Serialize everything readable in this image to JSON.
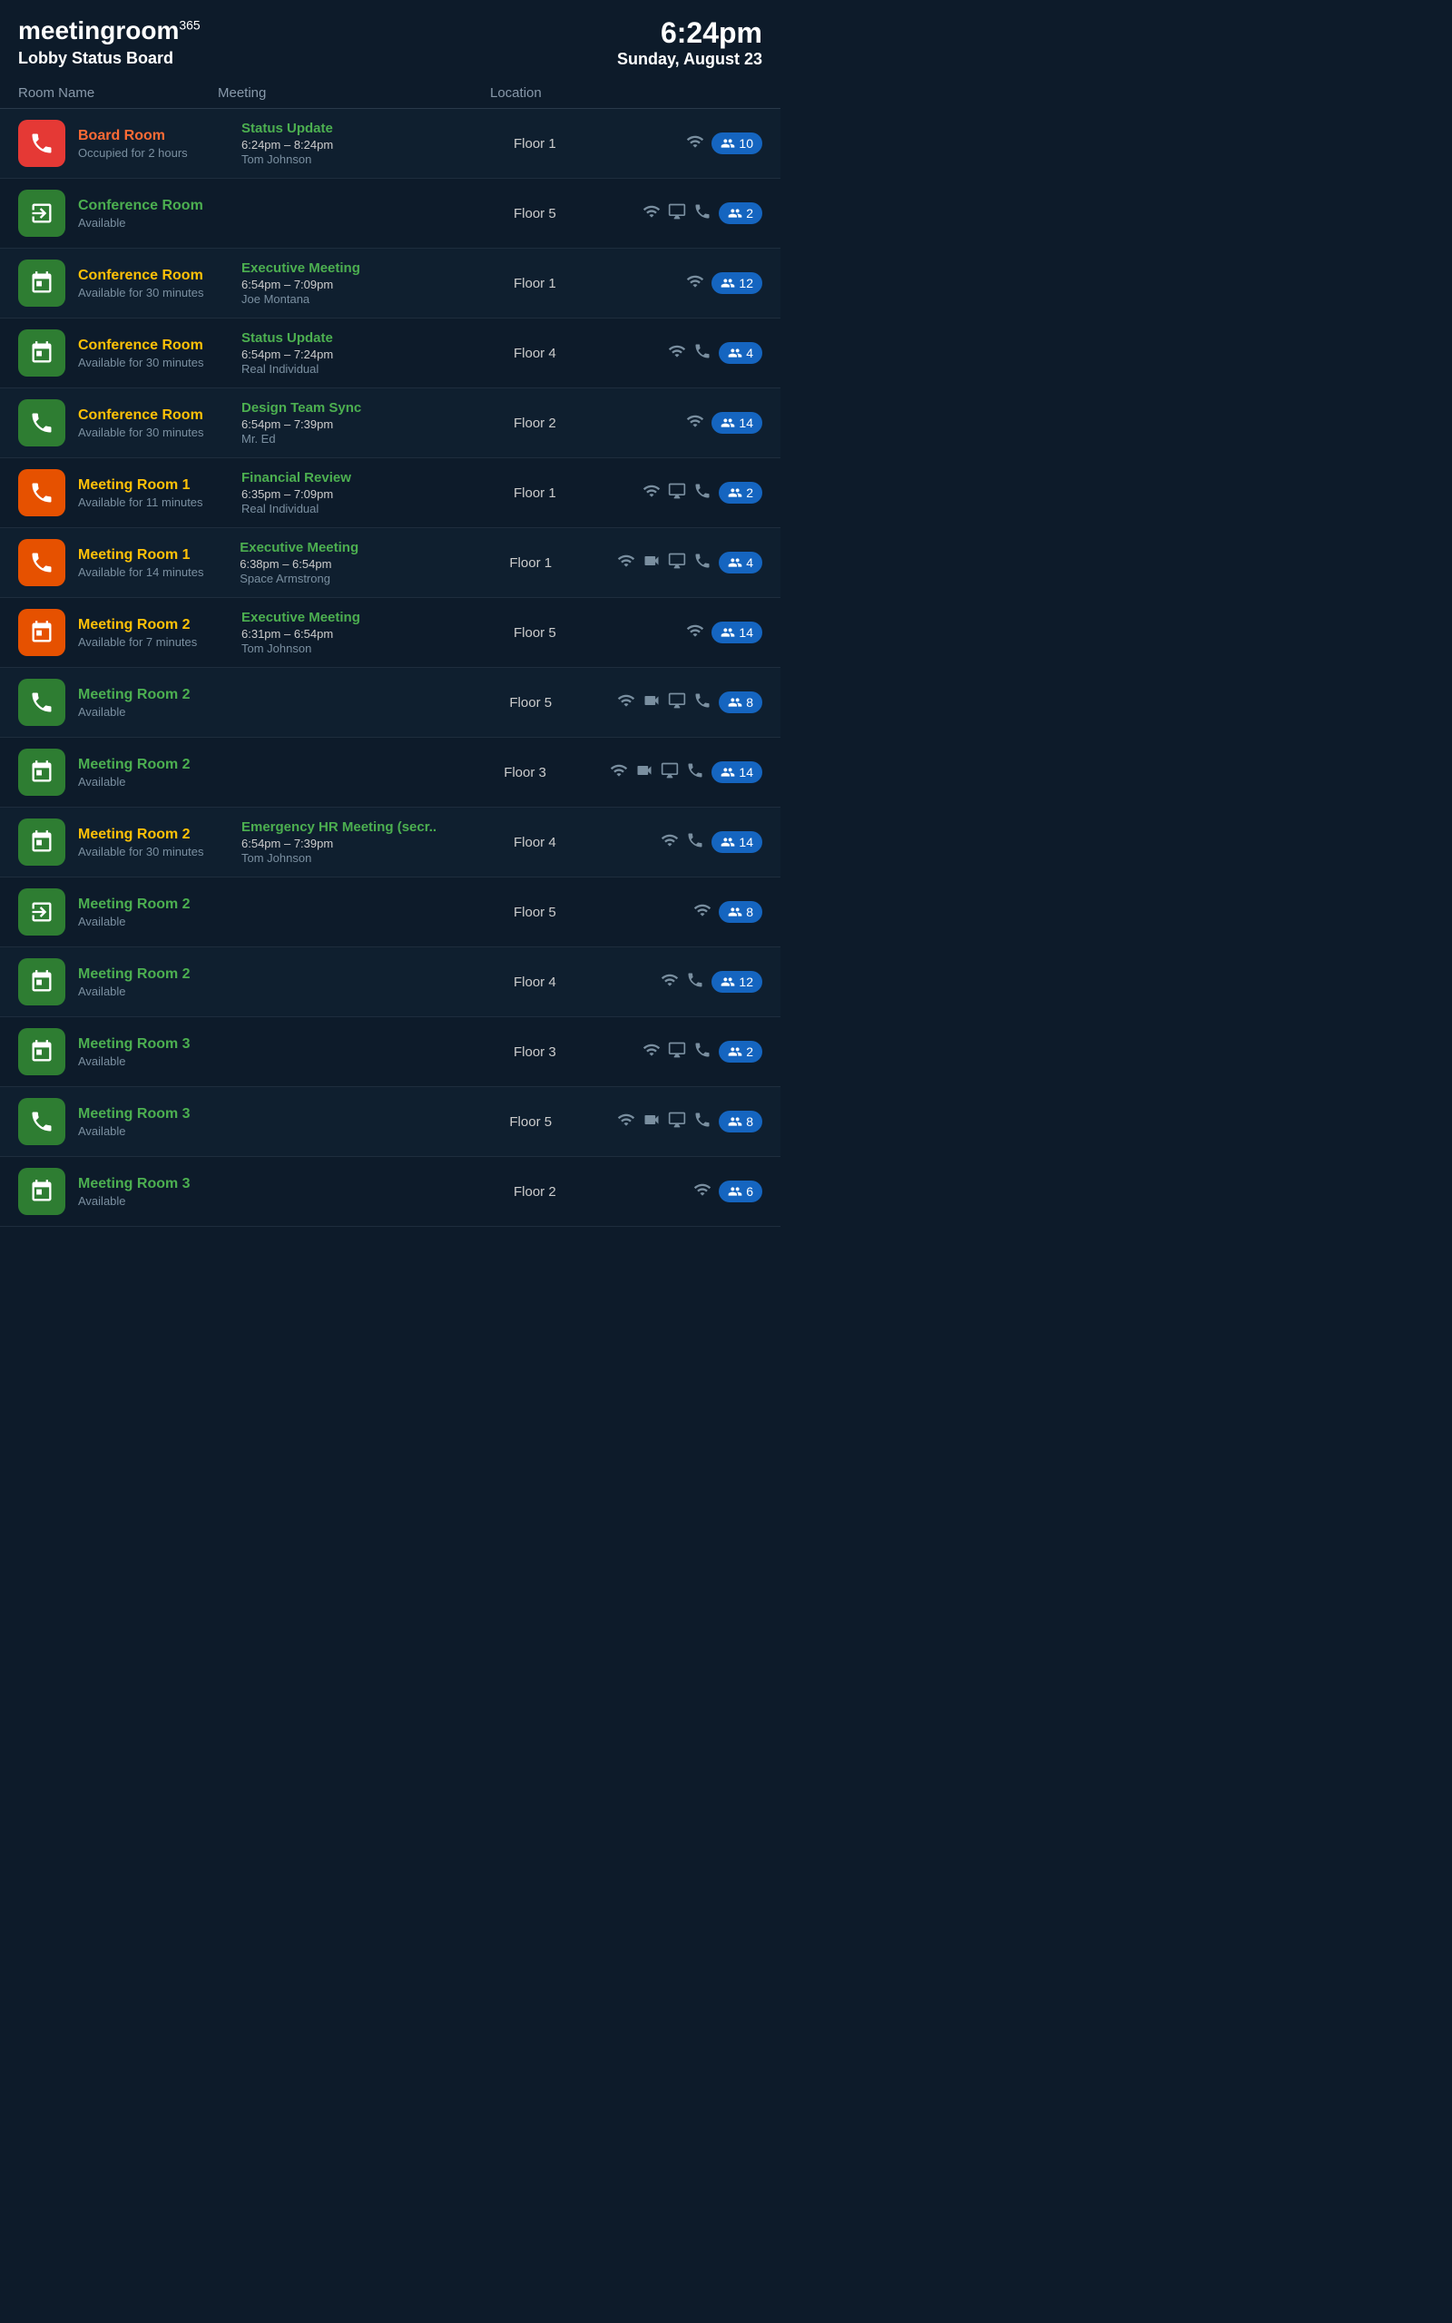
{
  "header": {
    "logo": "meetingroom",
    "logo_sup": "365",
    "subtitle": "Lobby Status Board",
    "time": "6:24pm",
    "date": "Sunday, August 23"
  },
  "columns": {
    "room_name": "Room Name",
    "meeting": "Meeting",
    "location": "Location"
  },
  "rooms": [
    {
      "id": 1,
      "name": "Board Room",
      "status": "Occupied for 2 hours",
      "status_type": "occupied",
      "icon_type": "red",
      "icon": "phone",
      "meeting_title": "Status Update",
      "meeting_time": "6:24pm – 8:24pm",
      "organizer": "Tom Johnson",
      "location": "Floor 1",
      "amenities": [
        "wifi"
      ],
      "capacity": 10
    },
    {
      "id": 2,
      "name": "Conference Room",
      "status": "Available",
      "status_type": "available",
      "icon_type": "green",
      "icon": "exit",
      "meeting_title": "",
      "meeting_time": "",
      "organizer": "",
      "location": "Floor 5",
      "amenities": [
        "wifi",
        "monitor",
        "phone"
      ],
      "capacity": 2
    },
    {
      "id": 3,
      "name": "Conference Room",
      "status": "Available for 30 minutes",
      "status_type": "soon",
      "icon_type": "green",
      "icon": "calendar",
      "meeting_title": "Executive Meeting",
      "meeting_time": "6:54pm – 7:09pm",
      "organizer": "Joe Montana",
      "location": "Floor 1",
      "amenities": [
        "wifi"
      ],
      "capacity": 12
    },
    {
      "id": 4,
      "name": "Conference Room",
      "status": "Available for 30 minutes",
      "status_type": "soon",
      "icon_type": "green",
      "icon": "calendar",
      "meeting_title": "Status Update",
      "meeting_time": "6:54pm – 7:24pm",
      "organizer": "Real Individual",
      "location": "Floor 4",
      "amenities": [
        "wifi",
        "phone"
      ],
      "capacity": 4
    },
    {
      "id": 5,
      "name": "Conference Room",
      "status": "Available for 30 minutes",
      "status_type": "soon",
      "icon_type": "green",
      "icon": "phone",
      "meeting_title": "Design Team Sync",
      "meeting_time": "6:54pm – 7:39pm",
      "organizer": "Mr. Ed",
      "location": "Floor 2",
      "amenities": [
        "wifi"
      ],
      "capacity": 14
    },
    {
      "id": 6,
      "name": "Meeting Room 1",
      "status": "Available for 11 minutes",
      "status_type": "soon",
      "icon_type": "orange",
      "icon": "phone",
      "meeting_title": "Financial Review",
      "meeting_time": "6:35pm – 7:09pm",
      "organizer": "Real Individual",
      "location": "Floor 1",
      "amenities": [
        "wifi",
        "monitor",
        "phone"
      ],
      "capacity": 2
    },
    {
      "id": 7,
      "name": "Meeting Room 1",
      "status": "Available for 14 minutes",
      "status_type": "soon",
      "icon_type": "orange",
      "icon": "phone",
      "meeting_title": "Executive Meeting",
      "meeting_time": "6:38pm – 6:54pm",
      "organizer": "Space Armstrong",
      "location": "Floor 1",
      "amenities": [
        "wifi",
        "video",
        "monitor",
        "phone"
      ],
      "capacity": 4
    },
    {
      "id": 8,
      "name": "Meeting Room 2",
      "status": "Available for 7 minutes",
      "status_type": "soon",
      "icon_type": "orange",
      "icon": "calendar",
      "meeting_title": "Executive Meeting",
      "meeting_time": "6:31pm – 6:54pm",
      "organizer": "Tom Johnson",
      "location": "Floor 5",
      "amenities": [
        "wifi"
      ],
      "capacity": 14
    },
    {
      "id": 9,
      "name": "Meeting Room 2",
      "status": "Available",
      "status_type": "available",
      "icon_type": "green",
      "icon": "phone",
      "meeting_title": "",
      "meeting_time": "",
      "organizer": "",
      "location": "Floor 5",
      "amenities": [
        "wifi",
        "video",
        "monitor",
        "phone"
      ],
      "capacity": 8
    },
    {
      "id": 10,
      "name": "Meeting Room 2",
      "status": "Available",
      "status_type": "available",
      "icon_type": "green",
      "icon": "calendar",
      "meeting_title": "",
      "meeting_time": "",
      "organizer": "",
      "location": "Floor 3",
      "amenities": [
        "wifi",
        "video",
        "monitor",
        "phone"
      ],
      "capacity": 14
    },
    {
      "id": 11,
      "name": "Meeting Room 2",
      "status": "Available for 30 minutes",
      "status_type": "soon",
      "icon_type": "green",
      "icon": "calendar",
      "meeting_title": "Emergency HR Meeting (secr..",
      "meeting_time": "6:54pm – 7:39pm",
      "organizer": "Tom Johnson",
      "location": "Floor 4",
      "amenities": [
        "wifi",
        "phone"
      ],
      "capacity": 14
    },
    {
      "id": 12,
      "name": "Meeting Room 2",
      "status": "Available",
      "status_type": "available",
      "icon_type": "green",
      "icon": "exit",
      "meeting_title": "",
      "meeting_time": "",
      "organizer": "",
      "location": "Floor 5",
      "amenities": [
        "wifi"
      ],
      "capacity": 8
    },
    {
      "id": 13,
      "name": "Meeting Room 2",
      "status": "Available",
      "status_type": "available",
      "icon_type": "green",
      "icon": "calendar",
      "meeting_title": "",
      "meeting_time": "",
      "organizer": "",
      "location": "Floor 4",
      "amenities": [
        "wifi",
        "phone"
      ],
      "capacity": 12
    },
    {
      "id": 14,
      "name": "Meeting Room 3",
      "status": "Available",
      "status_type": "available",
      "icon_type": "green",
      "icon": "calendar",
      "meeting_title": "",
      "meeting_time": "",
      "organizer": "",
      "location": "Floor 3",
      "amenities": [
        "wifi",
        "monitor",
        "phone"
      ],
      "capacity": 2
    },
    {
      "id": 15,
      "name": "Meeting Room 3",
      "status": "Available",
      "status_type": "available",
      "icon_type": "green",
      "icon": "phone",
      "meeting_title": "",
      "meeting_time": "",
      "organizer": "",
      "location": "Floor 5",
      "amenities": [
        "wifi",
        "video",
        "monitor",
        "phone"
      ],
      "capacity": 8
    },
    {
      "id": 16,
      "name": "Meeting Room 3",
      "status": "Available",
      "status_type": "available",
      "icon_type": "green",
      "icon": "calendar",
      "meeting_title": "",
      "meeting_time": "",
      "organizer": "",
      "location": "Floor 2",
      "amenities": [
        "wifi"
      ],
      "capacity": 6
    }
  ]
}
